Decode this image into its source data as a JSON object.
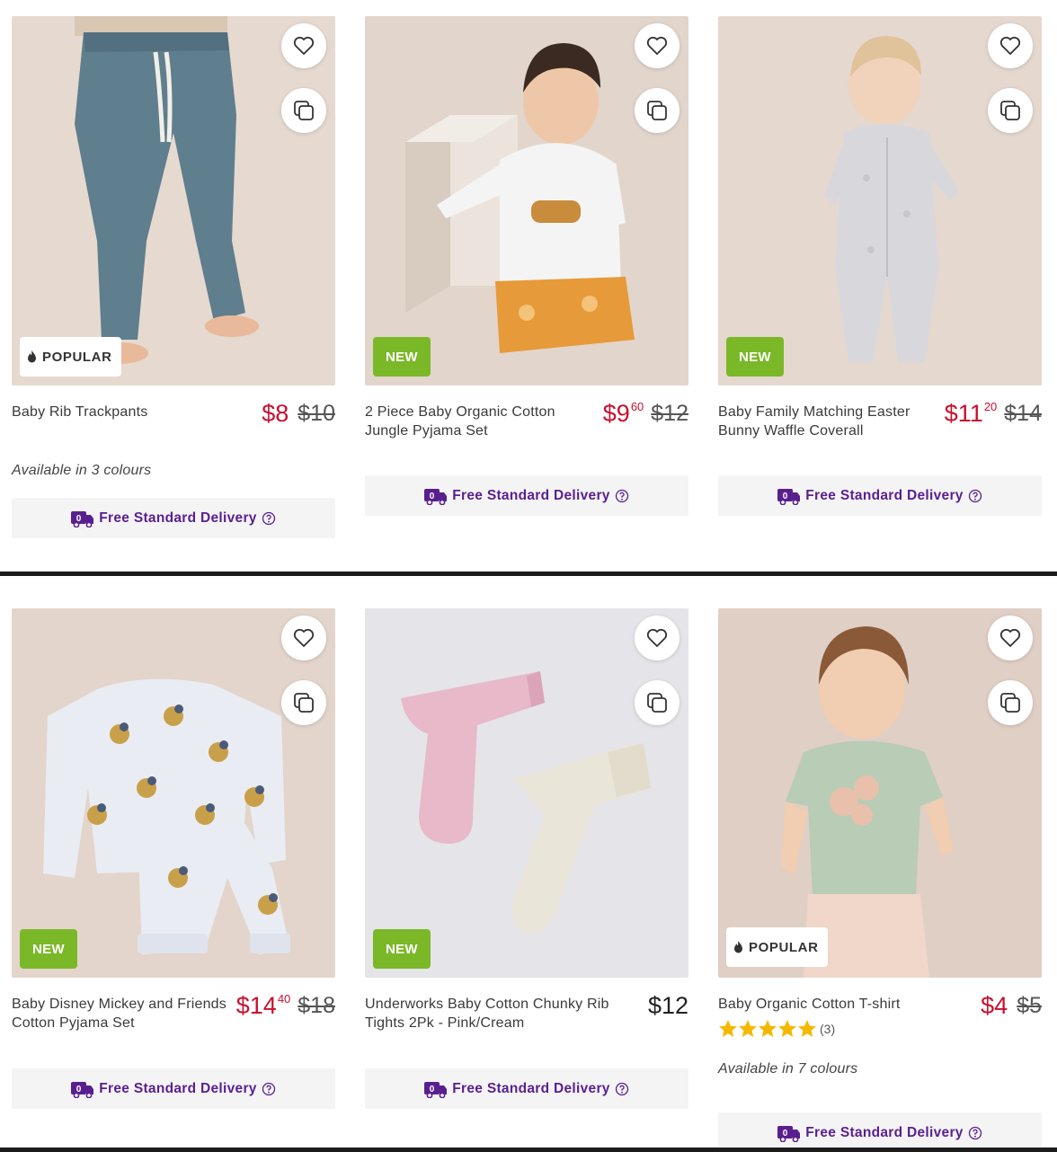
{
  "delivery_label": "Free Standard Delivery",
  "icons": {
    "favourite": "heart-icon",
    "compare": "compare-icon",
    "popular": "flame-icon",
    "delivery": "delivery-truck-icon",
    "help": "question-circle-icon",
    "rating": "star-icon"
  },
  "colors": {
    "sale_price": "#c8102e",
    "new_badge": "#7ab828",
    "delivery_text": "#5a1f8f",
    "star": "#f5b800"
  },
  "products": [
    {
      "title": "Baby Rib Trackpants",
      "badge": "POPULAR",
      "price": {
        "dollars": "$8",
        "cents": "",
        "was": "$10"
      },
      "colours": "Available in 3 colours"
    },
    {
      "title": "2 Piece Baby Organic Cotton Jungle Pyjama Set",
      "badge": "NEW",
      "price": {
        "dollars": "$9",
        "cents": "60",
        "was": "$12"
      }
    },
    {
      "title": "Baby Family Matching Easter Bunny Waffle Coverall",
      "badge": "NEW",
      "price": {
        "dollars": "$11",
        "cents": "20",
        "was": "$14"
      }
    },
    {
      "title": "Baby Disney Mickey and Friends Cotton Pyjama Set",
      "badge": "NEW",
      "price": {
        "dollars": "$14",
        "cents": "40",
        "was": "$18"
      }
    },
    {
      "title": "Underworks Baby Cotton Chunky Rib Tights 2Pk - Pink/Cream",
      "badge": "NEW",
      "price": {
        "regular": "$12"
      }
    },
    {
      "title": "Baby Organic Cotton T-shirt",
      "badge": "POPULAR",
      "price": {
        "dollars": "$4",
        "cents": "",
        "was": "$5"
      },
      "rating": {
        "stars": 5,
        "count": "(3)"
      },
      "colours": "Available in 7 colours"
    }
  ]
}
